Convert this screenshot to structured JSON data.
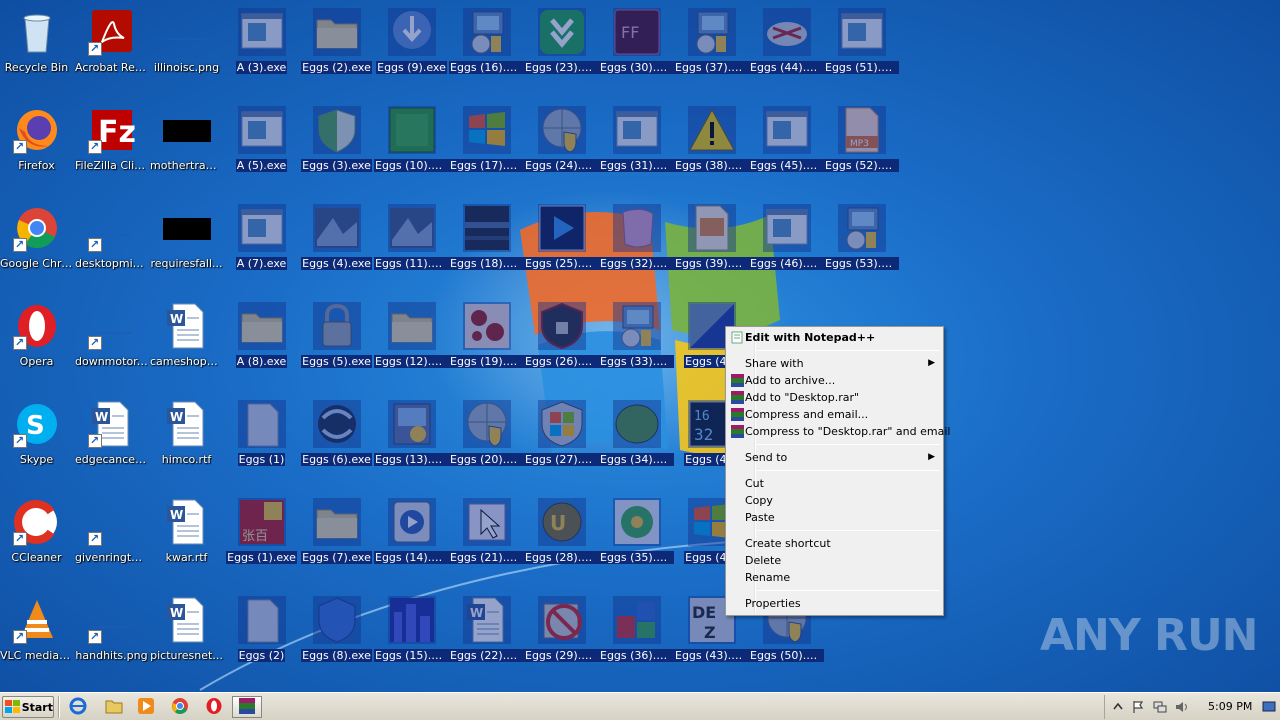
{
  "desktop": {
    "icons": [
      {
        "label": "Recycle Bin",
        "icon": "recycle-bin-icon"
      },
      {
        "label": "Acrobat Reader DC",
        "icon": "acrobat-reader-icon"
      },
      {
        "label": "illinoisc.png",
        "icon": "image-file-icon"
      },
      {
        "label": "A (3).exe",
        "icon": "exe-icon"
      },
      {
        "label": "Eggs (2).exe",
        "icon": "folder-icon"
      },
      {
        "label": "Eggs (9).exe",
        "icon": "download-shield-icon"
      },
      {
        "label": "Eggs (16).exe",
        "icon": "installer-icon"
      },
      {
        "label": "Eggs (23).exe",
        "icon": "green-arrow-icon"
      },
      {
        "label": "Eggs (30).exe",
        "icon": "ffd-icon"
      },
      {
        "label": "Eggs (37).exe",
        "icon": "installer-icon"
      },
      {
        "label": "Eggs (44).exe",
        "icon": "robot-icon"
      },
      {
        "label": "Eggs (51).exe",
        "icon": "exe-icon"
      },
      {
        "label": "Firefox",
        "icon": "firefox-icon"
      },
      {
        "label": "FileZilla Client",
        "icon": "filezilla-icon"
      },
      {
        "label": "mothertrad...",
        "icon": "black-image-icon"
      },
      {
        "label": "A (5).exe",
        "icon": "exe-icon"
      },
      {
        "label": "Eggs (3).exe",
        "icon": "shield-icon"
      },
      {
        "label": "Eggs (10).exe",
        "icon": "green-square-icon"
      },
      {
        "label": "Eggs (17).exe",
        "icon": "windows-flag-icon"
      },
      {
        "label": "Eggs (24).exe",
        "icon": "globe-shield-icon"
      },
      {
        "label": "Eggs (31).exe",
        "icon": "exe-icon"
      },
      {
        "label": "Eggs (38).exe",
        "icon": "warning-icon"
      },
      {
        "label": "Eggs (45).exe",
        "icon": "exe-icon"
      },
      {
        "label": "Eggs (52).exe",
        "icon": "mp3-icon"
      },
      {
        "label": "Google Chrome",
        "icon": "chrome-icon"
      },
      {
        "label": "desktopmic...",
        "icon": "image-file-icon"
      },
      {
        "label": "requiresfall...",
        "icon": "black-image-icon"
      },
      {
        "label": "A (7).exe",
        "icon": "exe-icon"
      },
      {
        "label": "Eggs (4).exe",
        "icon": "blue-picture-icon"
      },
      {
        "label": "Eggs (11).exe",
        "icon": "blue-picture-icon"
      },
      {
        "label": "Eggs (18).exe",
        "icon": "dark-picture-icon"
      },
      {
        "label": "Eggs (25).exe",
        "icon": "play-icon"
      },
      {
        "label": "Eggs (32).exe",
        "icon": "paper-icon"
      },
      {
        "label": "Eggs (39).exe",
        "icon": "picture-file-icon"
      },
      {
        "label": "Eggs (46).exe",
        "icon": "exe-icon"
      },
      {
        "label": "Eggs (53).exe",
        "icon": "installer-icon"
      },
      {
        "label": "Opera",
        "icon": "opera-icon"
      },
      {
        "label": "downmotor....",
        "icon": "image-file-icon"
      },
      {
        "label": "cameshoppi...",
        "icon": "word-doc-icon"
      },
      {
        "label": "A (8).exe",
        "icon": "folder-icon"
      },
      {
        "label": "Eggs (5).exe",
        "icon": "lock-icon"
      },
      {
        "label": "Eggs (12).exe",
        "icon": "folder-icon"
      },
      {
        "label": "Eggs (19).exe",
        "icon": "red-pattern-icon"
      },
      {
        "label": "Eggs (26).exe",
        "icon": "dark-shield-icon"
      },
      {
        "label": "Eggs (33).exe",
        "icon": "installer-icon"
      },
      {
        "label": "Eggs (40)",
        "icon": "gradient-icon"
      },
      {
        "label": "Skype",
        "icon": "skype-icon"
      },
      {
        "label": "edgecancer....",
        "icon": "word-doc-icon"
      },
      {
        "label": "himco.rtf",
        "icon": "word-doc-icon"
      },
      {
        "label": "Eggs (1)",
        "icon": "blank-file-icon"
      },
      {
        "label": "Eggs (6).exe",
        "icon": "globe-arrows-icon"
      },
      {
        "label": "Eggs (13).exe",
        "icon": "setup-icon"
      },
      {
        "label": "Eggs (20).exe",
        "icon": "globe-shield-icon"
      },
      {
        "label": "Eggs (27).exe",
        "icon": "windows-shield-icon"
      },
      {
        "label": "Eggs (34).exe",
        "icon": "blob-icon"
      },
      {
        "label": "Eggs (41)",
        "icon": "digital-clock-icon"
      },
      {
        "label": "CCleaner",
        "icon": "ccleaner-icon"
      },
      {
        "label": "givenringto...",
        "icon": "image-file-icon"
      },
      {
        "label": "kwar.rtf",
        "icon": "word-doc-icon"
      },
      {
        "label": "Eggs (1).exe",
        "icon": "chinese-app-icon"
      },
      {
        "label": "Eggs (7).exe",
        "icon": "folder-icon"
      },
      {
        "label": "Eggs (14).exe",
        "icon": "media-icon"
      },
      {
        "label": "Eggs (21).exe",
        "icon": "cursor-icon"
      },
      {
        "label": "Eggs (28).exe",
        "icon": "uc-icon"
      },
      {
        "label": "Eggs (35).exe",
        "icon": "icq-icon"
      },
      {
        "label": "Eggs (42)",
        "icon": "windows-flag-icon"
      },
      {
        "label": "VLC media player",
        "icon": "vlc-icon"
      },
      {
        "label": "handhits.png",
        "icon": "image-file-icon"
      },
      {
        "label": "picturesnet...",
        "icon": "word-doc-icon"
      },
      {
        "label": "Eggs (2)",
        "icon": "blank-file-icon"
      },
      {
        "label": "Eggs (8).exe",
        "icon": "blue-shield-icon"
      },
      {
        "label": "Eggs (15).exe",
        "icon": "city-icon"
      },
      {
        "label": "Eggs (22).exe",
        "icon": "word-doc-icon"
      },
      {
        "label": "Eggs (29).exe",
        "icon": "no-entry-icon"
      },
      {
        "label": "Eggs (36).exe",
        "icon": "blocks-icon"
      },
      {
        "label": "Eggs (43).exe",
        "icon": "dez-icon"
      },
      {
        "label": "Eggs (50).exe",
        "icon": "globe-shield-icon"
      }
    ]
  },
  "context_menu": {
    "items": [
      {
        "label": "Edit with Notepad++",
        "bold": true,
        "icon": "notepadpp-icon"
      },
      {
        "sep": true
      },
      {
        "label": "Share with",
        "submenu": true
      },
      {
        "label": "Add to archive...",
        "icon": "winrar-icon"
      },
      {
        "label": "Add to \"Desktop.rar\"",
        "icon": "winrar-icon"
      },
      {
        "label": "Compress and email...",
        "icon": "winrar-icon"
      },
      {
        "label": "Compress to \"Desktop.rar\" and email",
        "icon": "winrar-icon"
      },
      {
        "sep": true
      },
      {
        "label": "Send to",
        "submenu": true
      },
      {
        "sep": true
      },
      {
        "label": "Cut"
      },
      {
        "label": "Copy"
      },
      {
        "label": "Paste"
      },
      {
        "sep": true
      },
      {
        "label": "Create shortcut"
      },
      {
        "label": "Delete"
      },
      {
        "label": "Rename"
      },
      {
        "sep": true
      },
      {
        "label": "Properties"
      }
    ]
  },
  "watermark": "ANY RUN",
  "taskbar": {
    "start_label": "Start",
    "clock": "5:09 PM",
    "pinned": [
      {
        "name": "ie-icon"
      },
      {
        "name": "explorer-icon"
      },
      {
        "name": "media-player-icon"
      },
      {
        "name": "chrome-icon"
      },
      {
        "name": "opera-icon"
      },
      {
        "name": "winrar-icon"
      }
    ]
  }
}
